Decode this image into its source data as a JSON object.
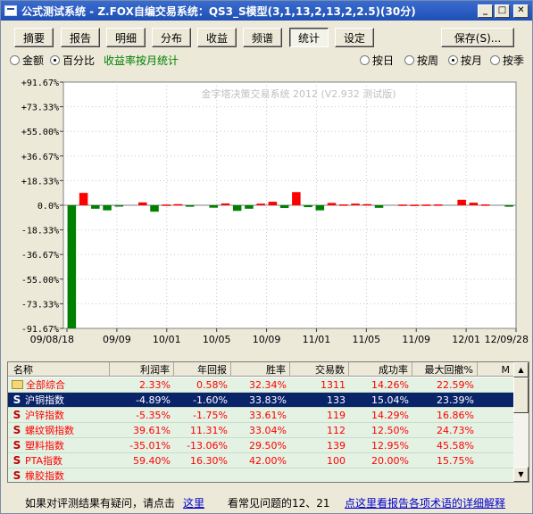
{
  "window": {
    "title": "公式测试系统 - Z.FOX自编交易系统：QS3_S模型(3,1,13,2,13,2,2.5)(30分)"
  },
  "toolbar": {
    "tabs": [
      "摘要",
      "报告",
      "明细",
      "分布",
      "收益",
      "频谱",
      "统计",
      "设定"
    ],
    "active_tab": "统计",
    "save_label": "保存(S)..."
  },
  "options": {
    "left": [
      {
        "label": "金额",
        "checked": false
      },
      {
        "label": "百分比",
        "checked": true
      }
    ],
    "caption": "收益率按月统计",
    "right": [
      {
        "label": "按日",
        "checked": false
      },
      {
        "label": "按周",
        "checked": false
      },
      {
        "label": "按月",
        "checked": true
      },
      {
        "label": "按季",
        "checked": false
      }
    ]
  },
  "chart_data": {
    "type": "bar",
    "watermark": "金字塔决策交易系统 2012 (V2.932 测试版)",
    "ylim": [
      -91.67,
      91.67
    ],
    "y_ticks": [
      "+91.67%",
      "+73.33%",
      "+55.00%",
      "+36.67%",
      "+18.33%",
      "0.0%",
      "-18.33%",
      "-36.67%",
      "-55.00%",
      "-73.33%",
      "-91.67%"
    ],
    "x_ticks": [
      "09/08/18",
      "09/09",
      "10/01",
      "10/05",
      "10/09",
      "11/01",
      "11/05",
      "11/09",
      "12/01",
      "12/09/28"
    ],
    "grid": true,
    "values": [
      -91.67,
      9.2,
      -2.6,
      -3.8,
      -1.0,
      0,
      2.1,
      -4.8,
      0.5,
      0.8,
      -1.1,
      0,
      -1.8,
      1.3,
      -4.2,
      -2.6,
      1.2,
      2.6,
      -2.0,
      9.8,
      -1.4,
      -3.8,
      1.7,
      0.6,
      1.2,
      0.8,
      -1.9,
      0,
      0.5,
      0.4,
      0.5,
      0.6,
      0,
      4.1,
      1.9,
      0.6,
      0,
      -1.1
    ]
  },
  "colors": {
    "positive": "#ff0000",
    "negative": "#008000",
    "grid_dot": "#c8c8c8",
    "watermark": "#c0c0c0"
  },
  "table": {
    "columns": [
      "名称",
      "利润率",
      "年回报",
      "胜率",
      "交易数",
      "成功率",
      "最大回撤%",
      "M"
    ],
    "rows": [
      {
        "icon": "folder-icon",
        "name": "全部综合",
        "profit": "2.33%",
        "annual": "0.58%",
        "win": "32.34%",
        "trades": "1311",
        "success": "14.26%",
        "drawdown": "22.59%",
        "selected": false
      },
      {
        "icon": "s-icon",
        "name": "沪铜指数",
        "profit": "-4.89%",
        "annual": "-1.60%",
        "win": "33.83%",
        "trades": "133",
        "success": "15.04%",
        "drawdown": "23.39%",
        "selected": true
      },
      {
        "icon": "s-icon",
        "name": "沪锌指数",
        "profit": "-5.35%",
        "annual": "-1.75%",
        "win": "33.61%",
        "trades": "119",
        "success": "14.29%",
        "drawdown": "16.86%",
        "selected": false
      },
      {
        "icon": "s-icon",
        "name": "螺纹钢指数",
        "profit": "39.61%",
        "annual": "11.31%",
        "win": "33.04%",
        "trades": "112",
        "success": "12.50%",
        "drawdown": "24.73%",
        "selected": false
      },
      {
        "icon": "s-icon",
        "name": "塑料指数",
        "profit": "-35.01%",
        "annual": "-13.06%",
        "win": "29.50%",
        "trades": "139",
        "success": "12.95%",
        "drawdown": "45.58%",
        "selected": false
      },
      {
        "icon": "s-icon",
        "name": "PTA指数",
        "profit": "59.40%",
        "annual": "16.30%",
        "win": "42.00%",
        "trades": "100",
        "success": "20.00%",
        "drawdown": "15.75%",
        "selected": false
      },
      {
        "icon": "s-icon",
        "name": "橡胶指数",
        "profit": "",
        "annual": "",
        "win": "",
        "trades": "",
        "success": "",
        "drawdown": "",
        "selected": false
      }
    ]
  },
  "status": {
    "question": "如果对评测结果有疑问，请点击",
    "here": "这里",
    "faq": "看常见问题的12、21",
    "terms_link": "点这里看报告各项术语的详细解释"
  }
}
